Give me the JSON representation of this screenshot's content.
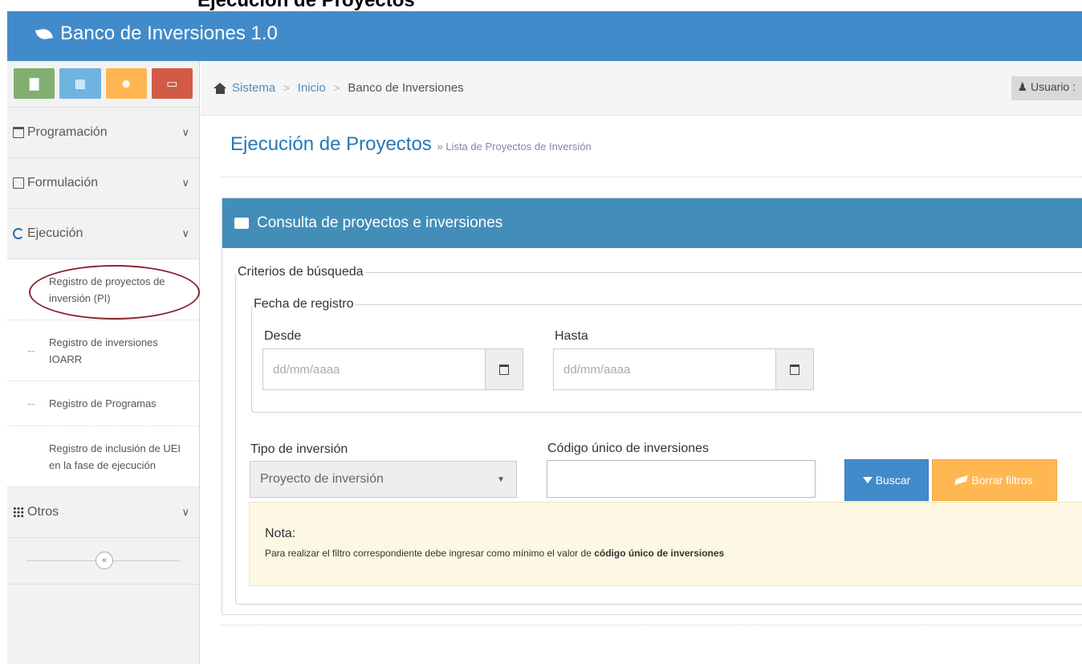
{
  "header": {
    "app_title": "Banco de Inversiones 1.0",
    "cut_heading": "Ejecución de Proyectos"
  },
  "sidebar": {
    "shortcut_icons": [
      "bar-chart-icon",
      "calendar-icon",
      "users-icon",
      "monitor-icon"
    ],
    "menu": [
      {
        "label": "Programación",
        "icon": "calendar-icon"
      },
      {
        "label": "Formulación",
        "icon": "edit-icon"
      },
      {
        "label": "Ejecución",
        "icon": "recycle-icon"
      },
      {
        "label": "Otros",
        "icon": "grid-icon"
      }
    ],
    "submenu": [
      "Registro de proyectos de inversión (PI)",
      "Registro de inversiones IOARR",
      "Registro de Programas",
      "Registro de inclusión de UEI en la fase de ejecución"
    ],
    "collapse_icon": "«"
  },
  "breadcrumb": {
    "items": [
      "Sistema",
      "Inicio",
      "Banco de Inversiones"
    ],
    "user_label": "Usuario :"
  },
  "page": {
    "title": "Ejecución de Proyectos",
    "subtitle": "» Lista de Proyectos de Inversión"
  },
  "panel": {
    "title": "Consulta de proyectos e inversiones",
    "criterios_legend": "Criterios de búsqueda",
    "fecha_legend": "Fecha de registro",
    "desde_label": "Desde",
    "hasta_label": "Hasta",
    "date_placeholder": "dd/mm/aaaa",
    "tipo_label": "Tipo de inversión",
    "tipo_selected": "Proyecto de inversión",
    "codigo_label": "Código único de inversiones",
    "codigo_value": "",
    "buscar_label": "Buscar",
    "borrar_label": "Borrar filtros"
  },
  "nota": {
    "title": "Nota:",
    "text_prefix": "Para realizar el filtro correspondiente debe ingresar como mínimo el valor de ",
    "text_bold": "código único de inversiones"
  },
  "colors": {
    "header_blue": "#428bca",
    "panel_blue": "#438eb9",
    "buscar_blue": "#428bca",
    "borrar_orange": "#ffb752",
    "nota_bg": "#fcf8e3",
    "annotation_oval": "#8b2530"
  }
}
